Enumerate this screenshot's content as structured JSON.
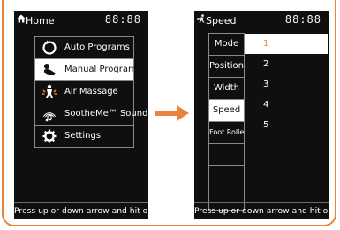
{
  "colors": {
    "accent": "#e8843e",
    "screen_bg": "#0f0f10",
    "selected_bg": "#ffffff"
  },
  "left_screen": {
    "header": {
      "icon": "home-icon",
      "title": "Home",
      "clock": "88:88"
    },
    "menu": [
      {
        "icon": "auto-programs-icon",
        "label": "Auto Programs",
        "selected": false
      },
      {
        "icon": "manual-program-icon",
        "label": "Manual Program",
        "selected": true
      },
      {
        "icon": "air-massage-icon",
        "label": "Air Massage",
        "selected": false
      },
      {
        "icon": "soothe-sounds-icon",
        "label": "SootheMe™ Sounds",
        "selected": false
      },
      {
        "icon": "settings-gear-icon",
        "label": "Settings",
        "selected": false
      }
    ],
    "footer": "Press up or down arrow and hit ok"
  },
  "arrow": {
    "icon": "right-arrow-icon"
  },
  "right_screen": {
    "header": {
      "icon": "speed-icon",
      "title": "Speed",
      "clock": "88:88"
    },
    "tabs": [
      {
        "label": "Mode",
        "selected": false
      },
      {
        "label": "Position",
        "selected": false
      },
      {
        "label": "Width",
        "selected": false
      },
      {
        "label": "Speed",
        "selected": true
      },
      {
        "label": "Foot Rollers",
        "selected": false
      },
      {
        "label": "",
        "selected": false
      },
      {
        "label": "",
        "selected": false
      },
      {
        "label": "",
        "selected": false
      }
    ],
    "values": [
      {
        "label": "1",
        "selected": true
      },
      {
        "label": "2",
        "selected": false
      },
      {
        "label": "3",
        "selected": false
      },
      {
        "label": "4",
        "selected": false
      },
      {
        "label": "5",
        "selected": false
      }
    ],
    "footer": "Press up or down arrow and hit ok"
  }
}
